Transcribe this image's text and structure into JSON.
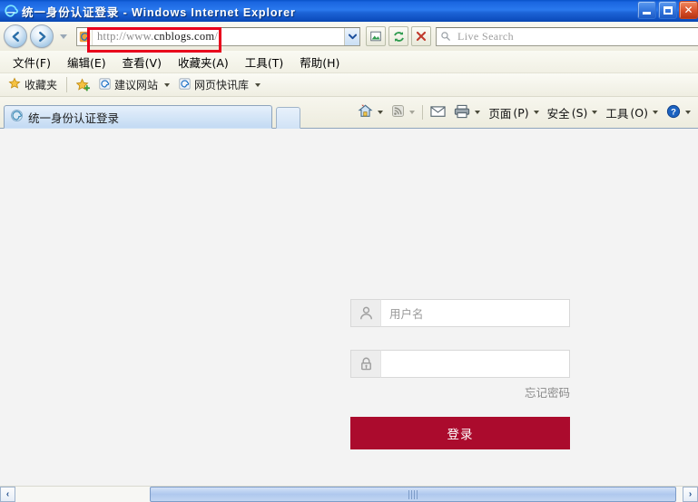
{
  "window": {
    "title": "统一身份认证登录 - Windows Internet Explorer",
    "icon": "ie-logo-icon",
    "controls": {
      "minimize": "minimize-button",
      "maximize": "maximize-button",
      "close": "close-button"
    }
  },
  "address_bar": {
    "back": "back-button",
    "forward": "forward-button",
    "recent_pages": "recent-pages-button",
    "favicon": "ie-favicon-icon",
    "url_scheme": "http://www.",
    "url_host": "cnblogs.com",
    "url_path": "/",
    "url_full": "http://www.cnblogs.com/",
    "dropdown": "address-dropdown-icon",
    "compatibility_button": "compatibility-view-button",
    "refresh_button": "refresh-button",
    "stop_button": "stop-button",
    "highlight_color": "#E8001C"
  },
  "search": {
    "placeholder": "Live Search",
    "value": "",
    "go_button": "search-go-icon"
  },
  "menubar": {
    "items": [
      {
        "label": "文件",
        "accel": "(F)"
      },
      {
        "label": "编辑",
        "accel": "(E)"
      },
      {
        "label": "查看",
        "accel": "(V)"
      },
      {
        "label": "收藏夹",
        "accel": "(A)"
      },
      {
        "label": "工具",
        "accel": "(T)"
      },
      {
        "label": "帮助",
        "accel": "(H)"
      }
    ]
  },
  "favorites_bar": {
    "favorites_label": "收藏夹",
    "add_to_favorites": "add-to-favorites-icon",
    "items": [
      {
        "label": "建议网站",
        "icon": "ie-site-icon"
      },
      {
        "label": "网页快讯库",
        "icon": "ie-site-icon"
      }
    ]
  },
  "tabs": {
    "items": [
      {
        "label": "统一身份认证登录",
        "icon": "page-loading-icon",
        "active": true
      }
    ],
    "new_tab": "new-tab-button"
  },
  "command_bar": {
    "items": [
      {
        "label": "",
        "icon": "home-icon",
        "has_caret": true
      },
      {
        "label": "",
        "icon": "rss-feed-icon",
        "has_caret": true
      },
      {
        "label": "",
        "icon": "mail-icon",
        "has_caret": false
      },
      {
        "label": "",
        "icon": "print-icon",
        "has_caret": true
      },
      {
        "label": "页面",
        "accel": "(P)",
        "has_caret": true
      },
      {
        "label": "安全",
        "accel": "(S)",
        "has_caret": true
      },
      {
        "label": "工具",
        "accel": "(O)",
        "has_caret": true
      },
      {
        "label": "",
        "icon": "help-icon",
        "has_caret": true
      }
    ]
  },
  "page": {
    "background": "#F3F3F3",
    "login": {
      "username": {
        "icon": "user-icon",
        "placeholder": "用户名",
        "value": ""
      },
      "password": {
        "icon": "lock-icon",
        "placeholder": "",
        "value": ""
      },
      "forgot_password": "忘记密码",
      "submit_label": "登录",
      "submit_color": "#AB0B2D"
    }
  },
  "status": {
    "scroll_left": "‹",
    "scroll_right": "›"
  }
}
